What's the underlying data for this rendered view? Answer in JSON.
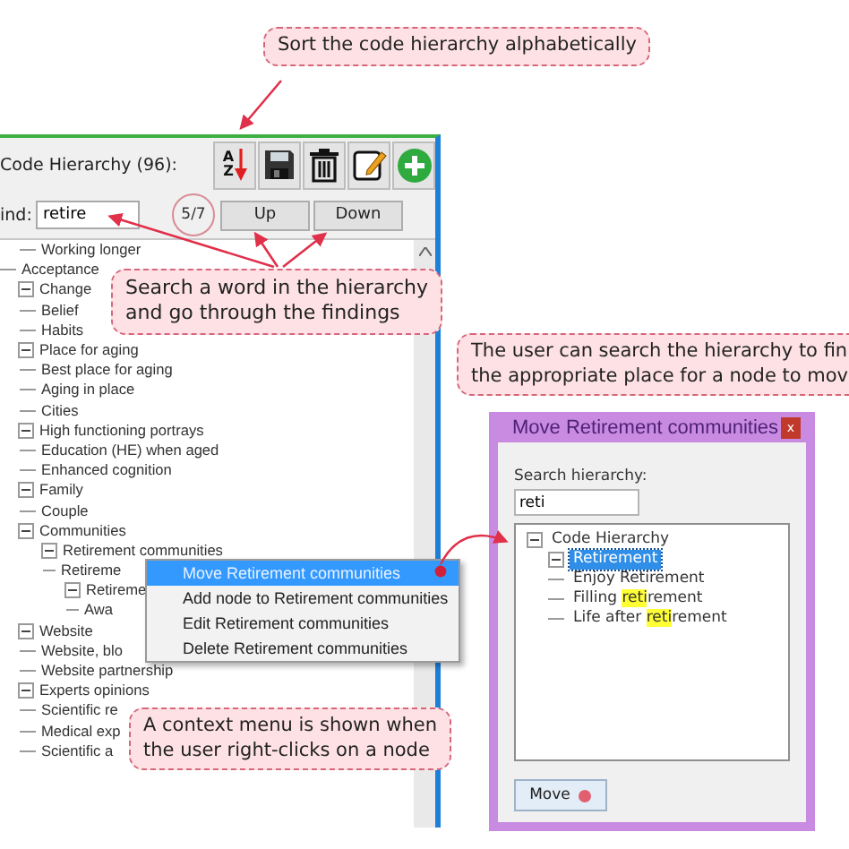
{
  "main_window": {
    "title": "Code Hierarchy (96):",
    "toolbar": [
      {
        "kind": "sort",
        "letters": [
          "A",
          "Z"
        ]
      },
      {
        "kind": "save"
      },
      {
        "kind": "delete"
      },
      {
        "kind": "edit"
      },
      {
        "kind": "add"
      }
    ],
    "find": {
      "label": "ind:",
      "value": "retire"
    },
    "match_counter": "5/7",
    "buttons": [
      "Up",
      "Down"
    ],
    "tree": {
      "continued_children": [
        {
          "label": "Working longer"
        }
      ],
      "items": [
        {
          "label": "Acceptance"
        },
        {
          "label": "Change",
          "expanded": true,
          "children": [
            {
              "label": "Belief"
            },
            {
              "label": "Habits"
            }
          ]
        },
        {
          "label": "Place for aging",
          "expanded": true,
          "children": [
            {
              "label": "Best place for aging"
            },
            {
              "label": "Aging in place"
            },
            {
              "label": "Cities"
            }
          ]
        },
        {
          "label": "High functioning portrays",
          "expanded": true,
          "children": [
            {
              "label": "Education (HE) when aged"
            },
            {
              "label": "Enhanced cognition"
            }
          ]
        },
        {
          "label": "Family",
          "expanded": true,
          "children": [
            {
              "label": "Couple"
            }
          ]
        },
        {
          "label": "Communities",
          "expanded": true,
          "children": [
            {
              "label": "Retirement communities",
              "expanded": true,
              "children": [
                {
                  "label": "Retireme"
                },
                {
                  "label": "Retireme",
                  "expanded": true,
                  "children": [
                    {
                      "label": "Awa"
                    }
                  ]
                }
              ]
            }
          ]
        },
        {
          "label": "Website",
          "expanded": true,
          "children": [
            {
              "label": "Website, blo"
            },
            {
              "label": "Website partnership"
            }
          ]
        },
        {
          "label": "Experts opinions",
          "expanded": true,
          "children": [
            {
              "label": "Scientific re"
            },
            {
              "label": "Medical exp"
            },
            {
              "label": "Scientific a"
            }
          ]
        }
      ]
    }
  },
  "context_menu": {
    "items": [
      {
        "label": "Move Retirement communities",
        "selected": true
      },
      {
        "label": "Add node to Retirement communities",
        "selected": false
      },
      {
        "label": "Edit Retirement communities",
        "selected": false
      },
      {
        "label": "Delete Retirement communities",
        "selected": false
      }
    ]
  },
  "dialog": {
    "title": "Move Retirement communities",
    "close": "x",
    "search_label": "Search hierarchy:",
    "search_value": "reti",
    "tree": [
      {
        "parts": [
          {
            "text": "Code Hierarchy"
          }
        ],
        "expanded": true,
        "selected": false,
        "children": [
          {
            "parts": [
              {
                "text": "Retirement"
              }
            ],
            "expanded": true,
            "selected": true,
            "children": [
              {
                "parts": [
                  {
                    "text": "Enjoy Retirement"
                  }
                ],
                "selected": false
              },
              {
                "parts": [
                  {
                    "text": "Filling "
                  },
                  {
                    "text": "reti",
                    "highlighted": true
                  },
                  {
                    "text": "rement"
                  }
                ],
                "selected": false
              },
              {
                "parts": [
                  {
                    "text": "Life after "
                  },
                  {
                    "text": "reti",
                    "highlighted": true
                  },
                  {
                    "text": "rement"
                  }
                ],
                "selected": false
              }
            ]
          }
        ]
      }
    ],
    "move_button": "Move"
  },
  "callouts": [
    {
      "lines": [
        "Sort the code hierarchy alphabetically"
      ]
    },
    {
      "lines": [
        "Search a word in the hierarchy",
        "and go through the findings"
      ]
    },
    {
      "lines": [
        "The user can search the hierarchy to fin",
        "the appropriate place for a node to mov"
      ]
    },
    {
      "lines": [
        "A context menu is shown when",
        "the user right-clicks on a node"
      ]
    }
  ]
}
